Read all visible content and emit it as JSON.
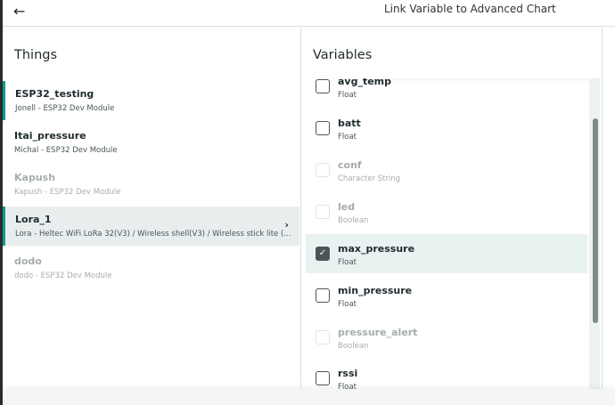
{
  "header": {
    "back_icon": "arrow-left-icon",
    "title": "Link Variable to Advanced Chart"
  },
  "things": {
    "heading": "Things",
    "items": [
      {
        "name": "ESP32_testing",
        "sub": "Jonell - ESP32 Dev Module"
      },
      {
        "name": "Itai_pressure",
        "sub": "Michal - ESP32 Dev Module"
      },
      {
        "name": "Kapush",
        "sub": "Kapush - ESP32 Dev Module"
      },
      {
        "name": "Lora_1",
        "sub": "Lora - Heltec WiFi LoRa 32(V3) / Wireless shell(V3) / Wireless stick lite (..."
      },
      {
        "name": "dodo",
        "sub": "dodo - ESP32 Dev Module"
      }
    ]
  },
  "variables": {
    "heading": "Variables",
    "items": [
      {
        "name": "avg_temp",
        "type": "Float"
      },
      {
        "name": "batt",
        "type": "Float"
      },
      {
        "name": "conf",
        "type": "Character String"
      },
      {
        "name": "led",
        "type": "Boolean"
      },
      {
        "name": "max_pressure",
        "type": "Float",
        "checked": true
      },
      {
        "name": "min_pressure",
        "type": "Float"
      },
      {
        "name": "pressure_alert",
        "type": "Boolean"
      },
      {
        "name": "rssi",
        "type": "Float"
      }
    ]
  },
  "colors": {
    "accent": "#0e9a94",
    "selected_bg": "#e8eeee",
    "checked_bg": "#e8f2f0"
  }
}
